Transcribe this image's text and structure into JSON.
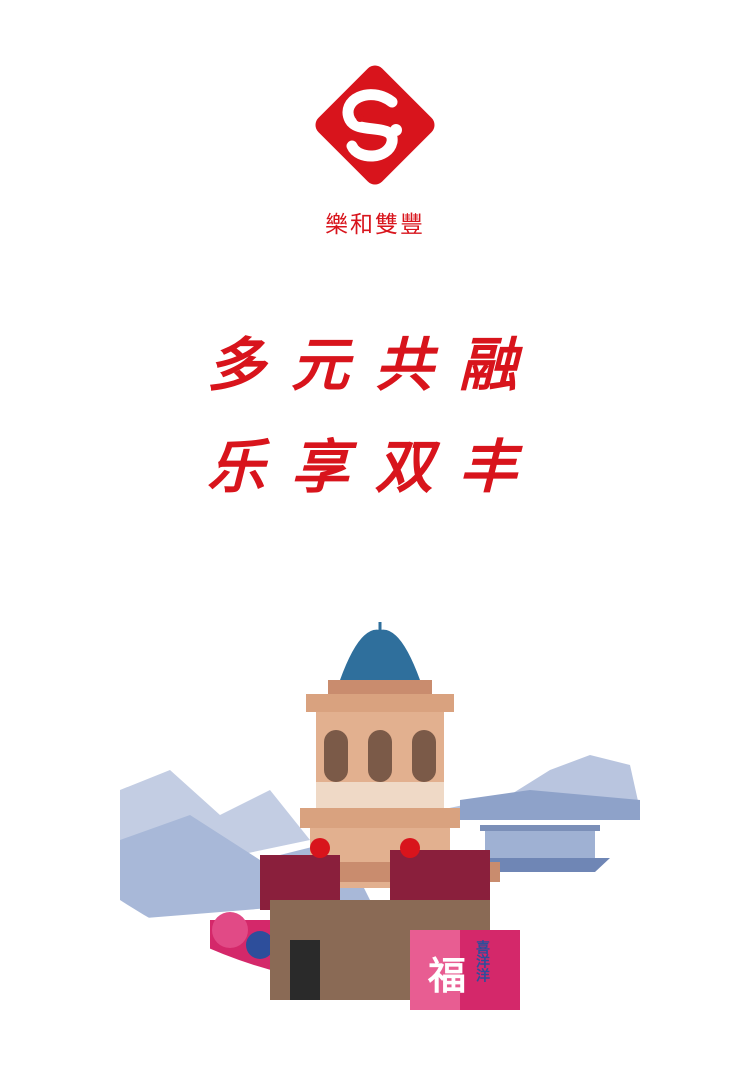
{
  "logo": {
    "name_text": "樂和雙豐",
    "colors": {
      "brand_red": "#d8141c",
      "white": "#ffffff"
    }
  },
  "slogan": {
    "line1": "多元共融",
    "line2": "乐享双丰"
  },
  "scene": {
    "banner_left": "福",
    "banner_right": "喜洋洋",
    "colors": {
      "dome": "#2f6f9c",
      "tower": "#d9a27f",
      "stone": "#8a6a55",
      "flowers": "#8a1f3c",
      "mountains": "#a8b8d8",
      "banner": "#d4286a"
    }
  }
}
